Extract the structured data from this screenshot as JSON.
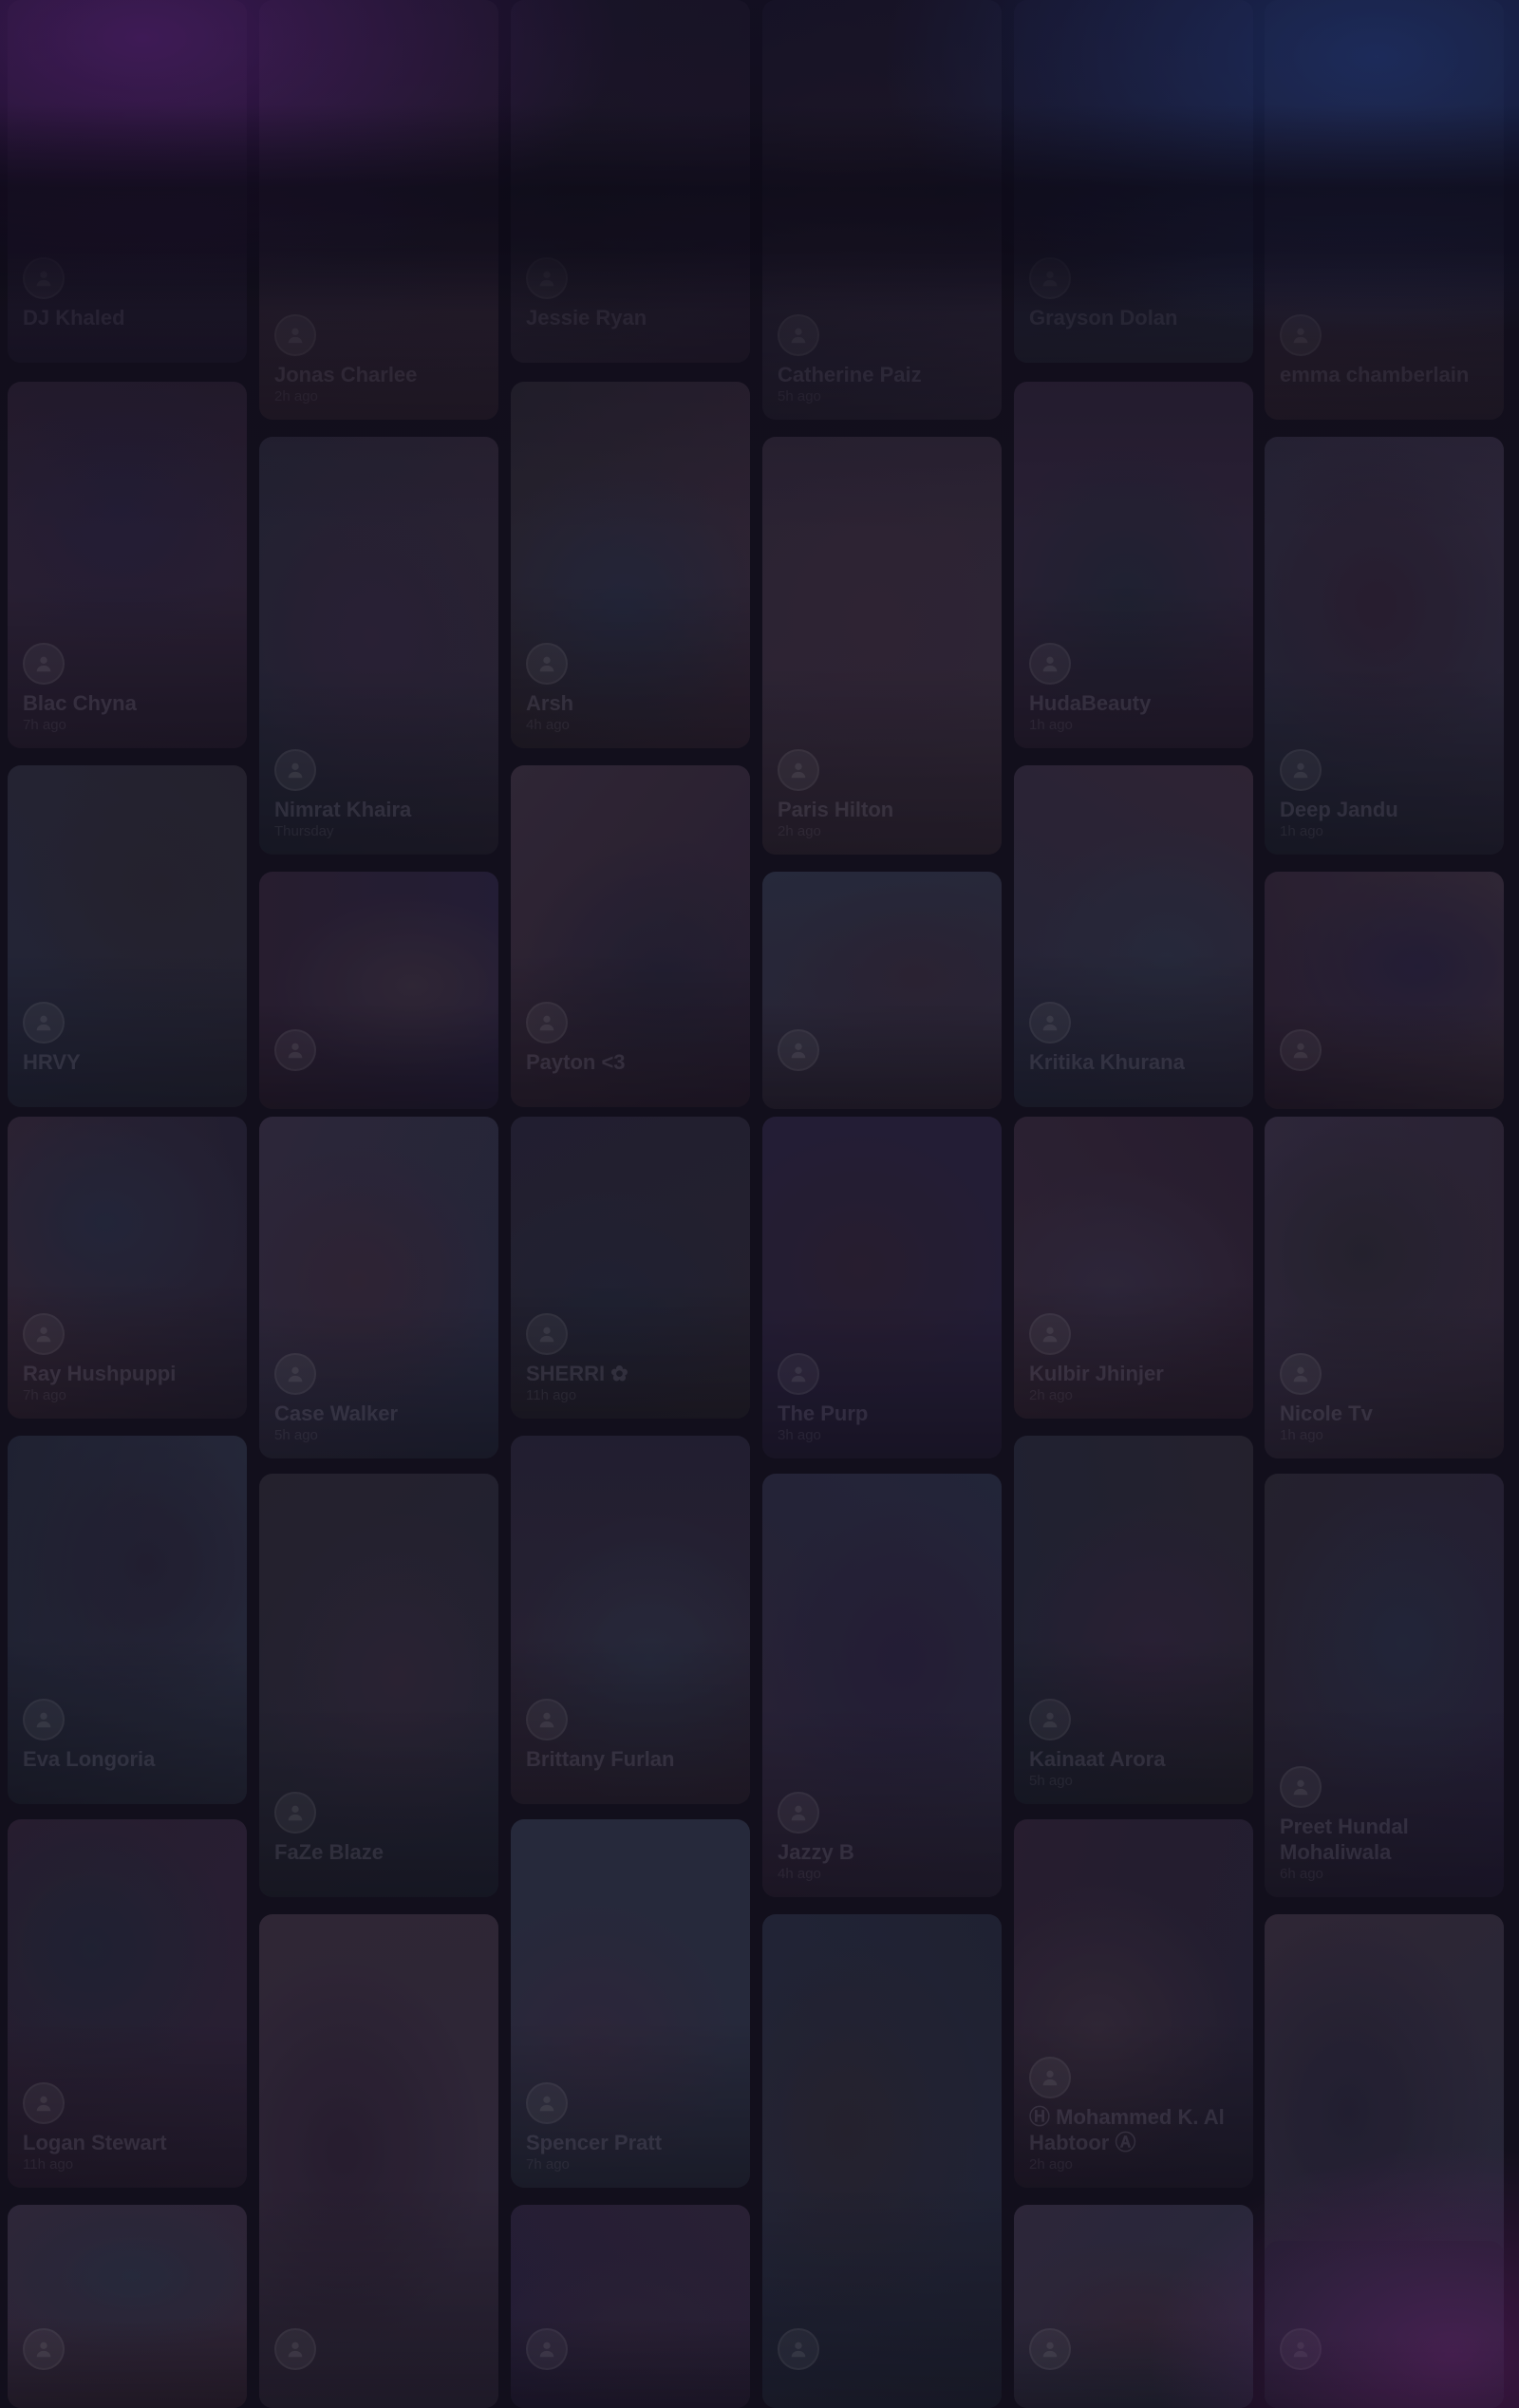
{
  "colors": {
    "background": "#15121f",
    "top_left_glow": "#7a2aa0",
    "top_right_glow": "#2850aa",
    "bottom_right_glow": "#962896"
  },
  "story_columns": [
    [
      {
        "name": "DJ Khaled",
        "subtitle": "",
        "avatar_icon": "user-icon"
      },
      {
        "name": "Blac Chyna",
        "subtitle": "7h ago",
        "avatar_icon": "user-icon"
      },
      {
        "name": "HRVY",
        "subtitle": "",
        "avatar_icon": "user-icon"
      },
      {
        "name": "Ray Hushpuppi",
        "subtitle": "7h ago",
        "avatar_icon": "user-icon"
      },
      {
        "name": "Eva Longoria",
        "subtitle": "",
        "avatar_icon": "user-icon"
      },
      {
        "name": "Logan Stewart",
        "subtitle": "11h ago",
        "avatar_icon": "user-icon"
      },
      {
        "name": "",
        "subtitle": "",
        "avatar_icon": "user-icon"
      }
    ],
    [
      {
        "name": "Jonas Charlee",
        "subtitle": "2h ago",
        "avatar_icon": "user-icon"
      },
      {
        "name": "Nimrat Khaira",
        "subtitle": "Thursday",
        "avatar_icon": "user-icon"
      },
      {
        "name": "",
        "subtitle": "",
        "avatar_icon": "user-icon"
      },
      {
        "name": "Case Walker",
        "subtitle": "5h ago",
        "avatar_icon": "user-icon"
      },
      {
        "name": "FaZe Blaze",
        "subtitle": "",
        "avatar_icon": "user-icon"
      },
      {
        "name": "",
        "subtitle": "",
        "avatar_icon": "user-icon"
      }
    ],
    [
      {
        "name": "Jessie Ryan",
        "subtitle": "",
        "avatar_icon": "user-icon"
      },
      {
        "name": "Arsh",
        "subtitle": "4h ago",
        "avatar_icon": "user-icon"
      },
      {
        "name": "Payton <3",
        "subtitle": "",
        "avatar_icon": "user-icon"
      },
      {
        "name": "SHERRI ✿",
        "subtitle": "11h ago",
        "avatar_icon": "user-icon"
      },
      {
        "name": "Brittany Furlan",
        "subtitle": "",
        "avatar_icon": "user-icon"
      },
      {
        "name": "Spencer Pratt",
        "subtitle": "7h ago",
        "avatar_icon": "user-icon"
      },
      {
        "name": "",
        "subtitle": "",
        "avatar_icon": "user-icon"
      }
    ],
    [
      {
        "name": "Catherine Paiz",
        "subtitle": "5h ago",
        "avatar_icon": "user-icon"
      },
      {
        "name": "Paris Hilton",
        "subtitle": "2h ago",
        "avatar_icon": "user-icon"
      },
      {
        "name": "",
        "subtitle": "",
        "avatar_icon": "user-icon"
      },
      {
        "name": "The Purp",
        "subtitle": "3h ago",
        "avatar_icon": "user-icon"
      },
      {
        "name": "Jazzy B",
        "subtitle": "4h ago",
        "avatar_icon": "user-icon"
      },
      {
        "name": "",
        "subtitle": "",
        "avatar_icon": "user-icon"
      }
    ],
    [
      {
        "name": "Grayson Dolan",
        "subtitle": "",
        "avatar_icon": "user-icon"
      },
      {
        "name": "HudaBeauty",
        "subtitle": "1h ago",
        "avatar_icon": "user-icon"
      },
      {
        "name": "Kritika Khurana",
        "subtitle": "",
        "avatar_icon": "user-icon"
      },
      {
        "name": "Kulbir Jhinjer",
        "subtitle": "2h ago",
        "avatar_icon": "user-icon"
      },
      {
        "name": "Kainaat Arora",
        "subtitle": "5h ago",
        "avatar_icon": "user-icon"
      },
      {
        "name": "Ⓗ Mohammed K. Al Habtoor Ⓐ",
        "subtitle": "2h ago",
        "avatar_icon": "user-icon"
      },
      {
        "name": "",
        "subtitle": "",
        "avatar_icon": "user-icon"
      }
    ],
    [
      {
        "name": "emma chamberlain",
        "subtitle": "",
        "avatar_icon": "user-icon"
      },
      {
        "name": "Deep Jandu",
        "subtitle": "1h ago",
        "avatar_icon": "user-icon"
      },
      {
        "name": "",
        "subtitle": "",
        "avatar_icon": "user-icon"
      },
      {
        "name": "Nicole Tv",
        "subtitle": "1h ago",
        "avatar_icon": "user-icon"
      },
      {
        "name": "Preet Hundal Mohaliwala",
        "subtitle": "6h ago",
        "avatar_icon": "user-icon"
      },
      {
        "name": "",
        "subtitle": "",
        "avatar_icon": "user-icon"
      },
      {
        "name": "",
        "subtitle": "",
        "avatar_icon": "user-icon"
      }
    ]
  ]
}
